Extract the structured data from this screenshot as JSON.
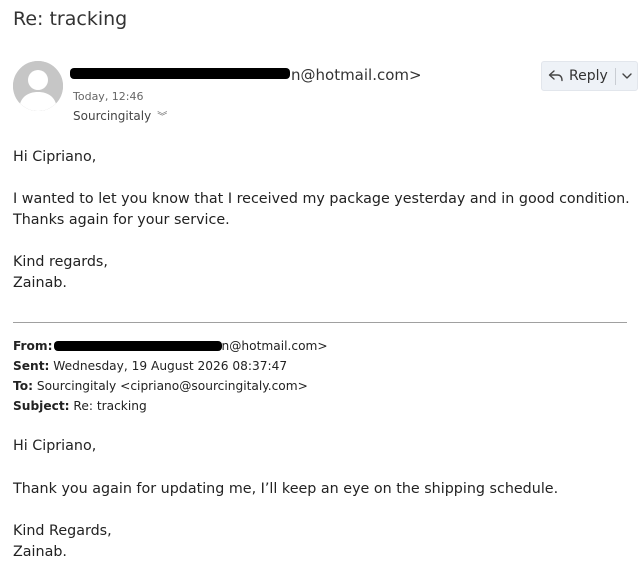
{
  "message": {
    "subject": "Re: tracking",
    "sender_email_suffix": "n@hotmail.com>",
    "date": "Today, 12:46",
    "recipient": "Sourcingitaly"
  },
  "actions": {
    "reply_label": "Reply"
  },
  "body": {
    "greeting": "Hi Cipriano,",
    "line1": "I wanted to let you know that I received my package yesterday and in good condition.",
    "line2": "Thanks again for your service.",
    "closing": "Kind regards,",
    "signature": "Zainab."
  },
  "quoted": {
    "from_label": "From:",
    "from_suffix": "n@hotmail.com>",
    "sent_label": "Sent:",
    "sent_value": "Wednesday, 19 August 2026 08:37:47",
    "to_label": "To:",
    "to_value": "Sourcingitaly <cipriano@sourcingitaly.com>",
    "subject_label": "Subject:",
    "subject_value": "Re: tracking",
    "greeting": "Hi Cipriano,",
    "line1": "Thank you again for updating me, I’ll keep an eye on the shipping schedule.",
    "closing": "Kind Regards,",
    "signature": "Zainab."
  },
  "icons": {
    "avatar": "person-avatar-icon",
    "reply": "reply-arrow-icon",
    "reply_menu": "chevron-down-icon",
    "recipient_expand": "double-chevron-down-icon"
  }
}
